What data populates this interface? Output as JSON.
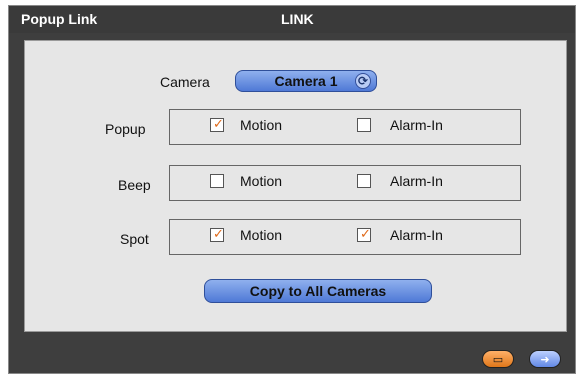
{
  "window": {
    "title": "Popup Link",
    "subtitle": "LINK"
  },
  "camera": {
    "label": "Camera",
    "selected": "Camera 1",
    "refresh_icon": "refresh-icon"
  },
  "rows": [
    {
      "label": "Popup",
      "motion_label": "Motion",
      "motion_checked": true,
      "alarm_label": "Alarm-In",
      "alarm_checked": false
    },
    {
      "label": "Beep",
      "motion_label": "Motion",
      "motion_checked": false,
      "alarm_label": "Alarm-In",
      "alarm_checked": false
    },
    {
      "label": "Spot",
      "motion_label": "Motion",
      "motion_checked": true,
      "alarm_label": "Alarm-In",
      "alarm_checked": true
    }
  ],
  "actions": {
    "copy_label": "Copy to All Cameras",
    "save_icon": "save-icon",
    "exit_icon": "exit-icon"
  },
  "colors": {
    "accent_blue": "#4f79d6",
    "accent_orange": "#e0771a",
    "check_orange": "#e06a1a"
  }
}
